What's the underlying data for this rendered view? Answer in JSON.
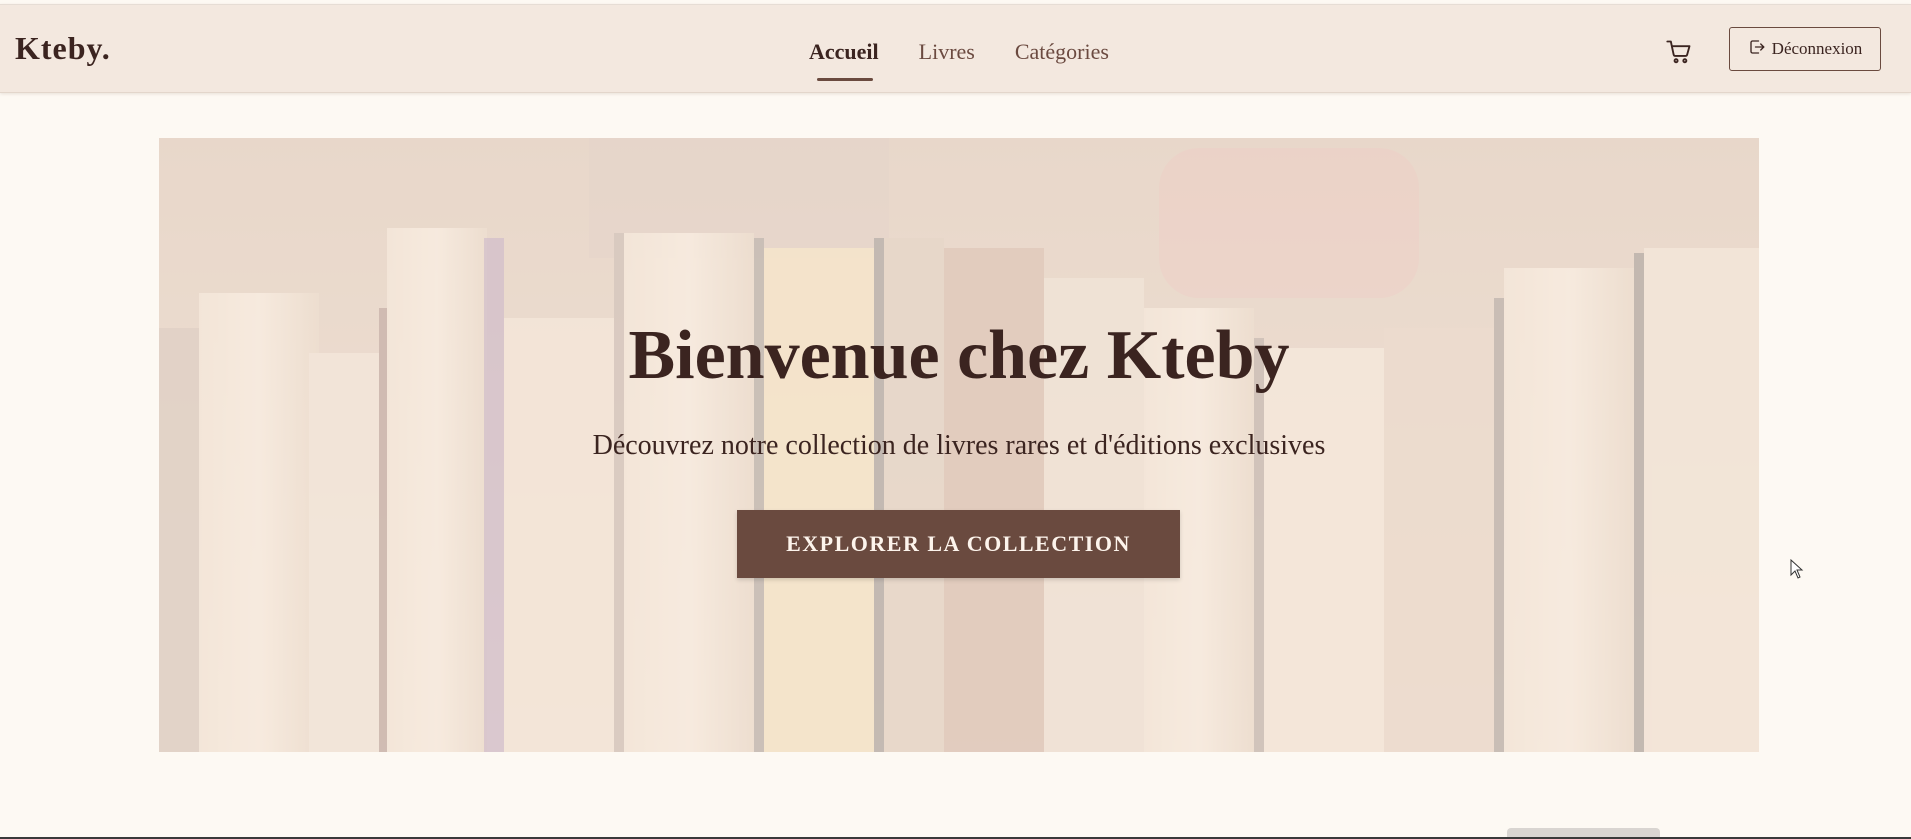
{
  "brand": {
    "name": "Kteby."
  },
  "nav": {
    "links": [
      {
        "label": "Accueil",
        "active": true
      },
      {
        "label": "Livres",
        "active": false
      },
      {
        "label": "Catégories",
        "active": false
      }
    ],
    "cart_icon": "shopping-cart-icon",
    "logout_label": "Déconnexion",
    "logout_icon": "logout-icon"
  },
  "hero": {
    "title": "Bienvenue chez Kteby",
    "subtitle": "Découvrez notre collection de livres rares et d'éditions exclusives",
    "cta_label": "EXPLORER LA COLLECTION",
    "background": "books-photo"
  },
  "colors": {
    "accent": "#6a4a3f",
    "text": "#3b2420",
    "navbar_bg": "#f3e8df",
    "page_bg": "#fdf9f3"
  }
}
